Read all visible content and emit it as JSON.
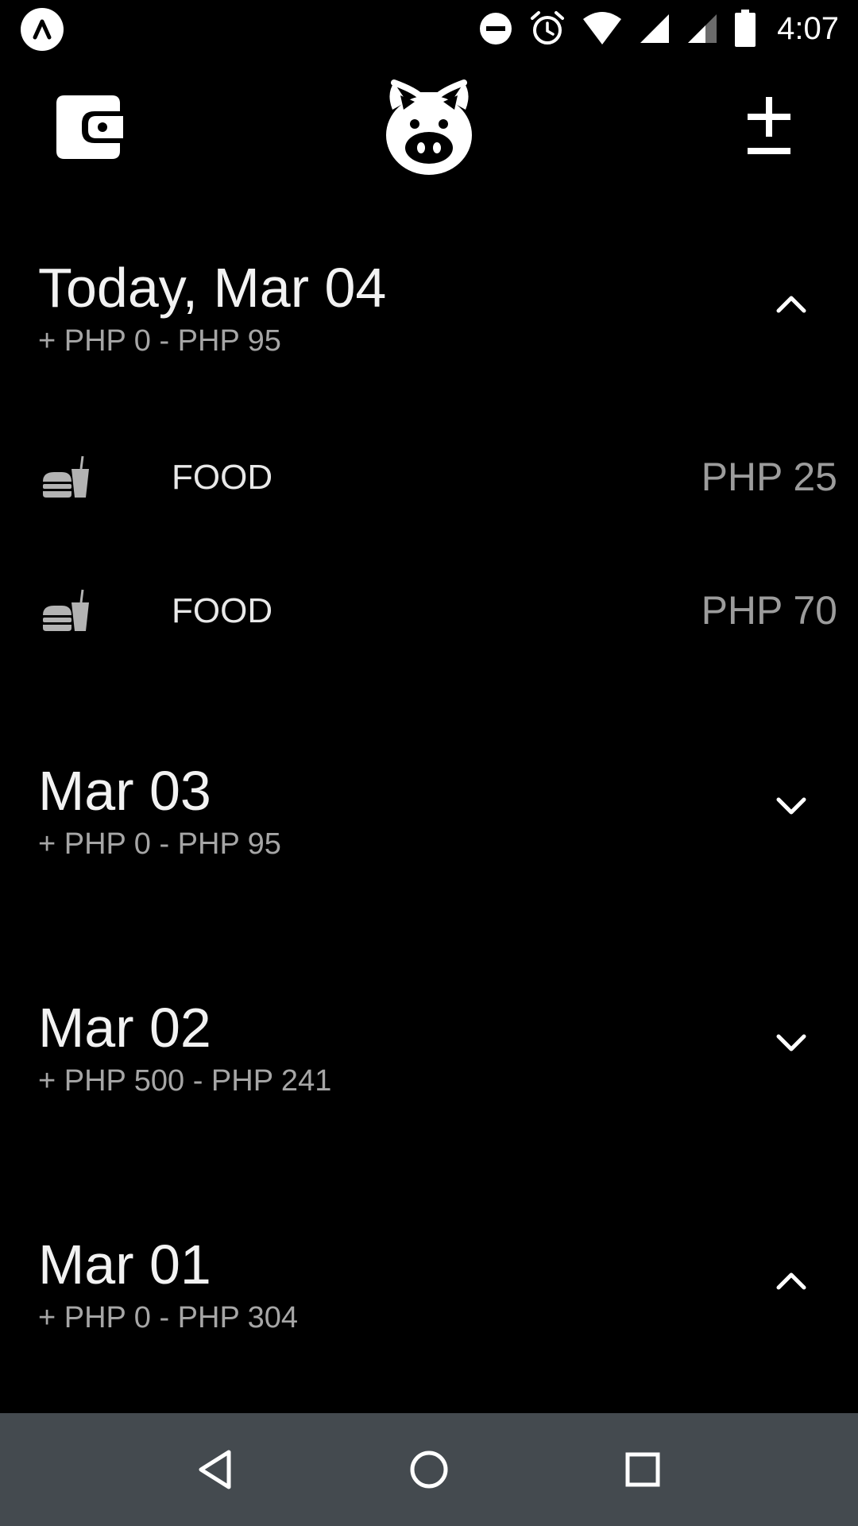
{
  "status_bar": {
    "time": "4:07",
    "icons": [
      "app-notification-icon",
      "do-not-disturb-icon",
      "alarm-icon",
      "wifi-icon",
      "signal-icon",
      "signal-weak-icon",
      "battery-icon"
    ]
  },
  "toolbar": {
    "icons": [
      "wallet-icon",
      "pig-icon",
      "plus-minus-icon"
    ]
  },
  "days": [
    {
      "title": "Today, Mar 04",
      "summary": "+ PHP 0 - PHP 95",
      "expanded": true,
      "transactions": [
        {
          "category": "FOOD",
          "amount": "PHP 25",
          "icon": "food-icon"
        },
        {
          "category": "FOOD",
          "amount": "PHP 70",
          "icon": "food-icon"
        }
      ]
    },
    {
      "title": "Mar 03",
      "summary": "+ PHP 0 - PHP 95",
      "expanded": false,
      "transactions": []
    },
    {
      "title": "Mar 02",
      "summary": "+ PHP 500 - PHP 241",
      "expanded": false,
      "transactions": []
    },
    {
      "title": "Mar 01",
      "summary": "+ PHP 0 - PHP 304",
      "expanded": true,
      "transactions": []
    }
  ],
  "nav_bar": {
    "icons": [
      "back-icon",
      "home-icon",
      "recents-icon"
    ]
  },
  "colors": {
    "background": "#000000",
    "title_text": "#f2f2f2",
    "summary_text": "#a6a6a6",
    "amount_text": "#9c9c9c",
    "nav_bar": "#444a4f"
  }
}
